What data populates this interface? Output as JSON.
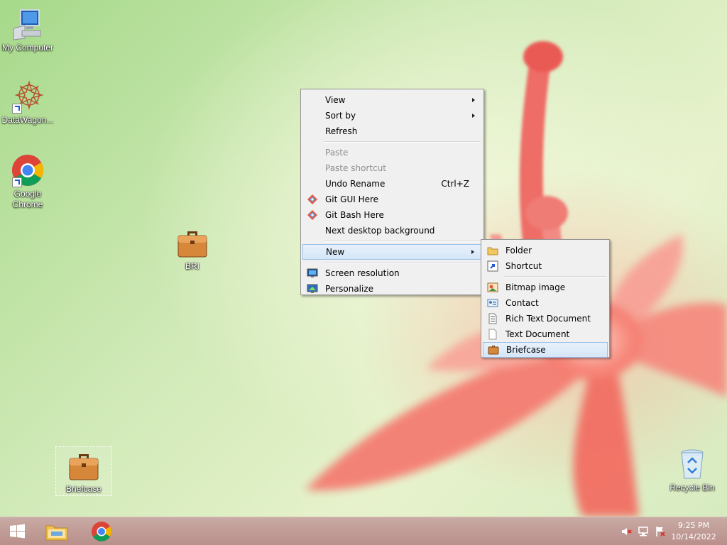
{
  "desktop": {
    "icons": [
      {
        "label": "My Computer",
        "icon": "computer-icon"
      },
      {
        "label": "DataWagon...",
        "icon": "datawagon-icon"
      },
      {
        "label": "Google Chrome",
        "icon": "chrome-icon"
      },
      {
        "label": "BRI",
        "icon": "briefcase-icon"
      },
      {
        "label": "Briefcase",
        "icon": "briefcase-icon"
      },
      {
        "label": "Recycle Bin",
        "icon": "recycle-bin-icon"
      }
    ]
  },
  "context_menu": {
    "items": [
      {
        "label": "View",
        "submenu": true
      },
      {
        "label": "Sort by",
        "submenu": true
      },
      {
        "label": "Refresh"
      },
      {
        "label": "Paste",
        "disabled": true
      },
      {
        "label": "Paste shortcut",
        "disabled": true
      },
      {
        "label": "Undo Rename",
        "shortcut": "Ctrl+Z"
      },
      {
        "label": "Git GUI Here",
        "icon": "git-icon"
      },
      {
        "label": "Git Bash Here",
        "icon": "git-icon"
      },
      {
        "label": "Next desktop background"
      },
      {
        "label": "New",
        "submenu": true,
        "highlighted": true
      },
      {
        "label": "Screen resolution",
        "icon": "screen-resolution-icon"
      },
      {
        "label": "Personalize",
        "icon": "personalize-icon"
      }
    ]
  },
  "new_submenu": {
    "items": [
      {
        "label": "Folder",
        "icon": "folder-icon"
      },
      {
        "label": "Shortcut",
        "icon": "shortcut-icon"
      },
      {
        "label": "Bitmap image",
        "icon": "bitmap-icon"
      },
      {
        "label": "Contact",
        "icon": "contact-icon"
      },
      {
        "label": "Rich Text Document",
        "icon": "rich-text-icon"
      },
      {
        "label": "Text Document",
        "icon": "text-document-icon"
      },
      {
        "label": "Briefcase",
        "icon": "briefcase-icon",
        "highlighted": true
      }
    ]
  },
  "taskbar": {
    "time": "9:25 PM",
    "date": "10/14/2022",
    "pinned": [
      "start-icon",
      "file-explorer-icon",
      "chrome-icon"
    ],
    "tray": [
      "speaker-muted-icon",
      "network-icon",
      "action-center-icon"
    ]
  },
  "colors": {
    "menu_highlight": "#d5e6f8",
    "taskbar": "#b98f8a"
  }
}
